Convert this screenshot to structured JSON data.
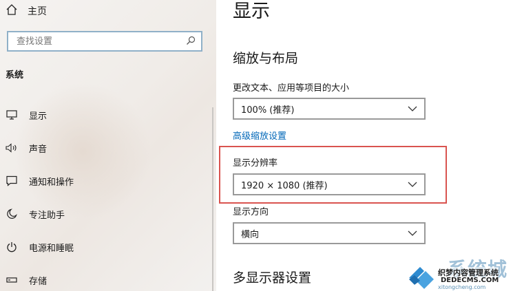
{
  "sidebar": {
    "home_label": "主页",
    "search_placeholder": "查找设置",
    "section_label": "系统",
    "items": [
      {
        "label": "显示",
        "icon": "monitor-icon"
      },
      {
        "label": "声音",
        "icon": "speaker-icon"
      },
      {
        "label": "通知和操作",
        "icon": "notification-icon"
      },
      {
        "label": "专注助手",
        "icon": "moon-icon"
      },
      {
        "label": "电源和睡眠",
        "icon": "power-icon"
      },
      {
        "label": "存储",
        "icon": "storage-icon"
      }
    ]
  },
  "main": {
    "page_title": "显示",
    "scale_section_title": "缩放与布局",
    "scale_label": "更改文本、应用等项目的大小",
    "scale_value": "100% (推荐)",
    "advanced_scale_link": "高级缩放设置",
    "resolution_label": "显示分辨率",
    "resolution_value": "1920 × 1080 (推荐)",
    "orientation_label": "显示方向",
    "orientation_value": "横向",
    "multi_display_title": "多显示器设置"
  },
  "watermark": {
    "brand": "系统城",
    "line1": "织梦内容管理系统",
    "line2": "DEDECMS.COM",
    "line3": "xitongcheng.com"
  },
  "colors": {
    "link": "#0067b8",
    "highlight_border": "#d9534f",
    "search_border": "#8fb0c8"
  }
}
